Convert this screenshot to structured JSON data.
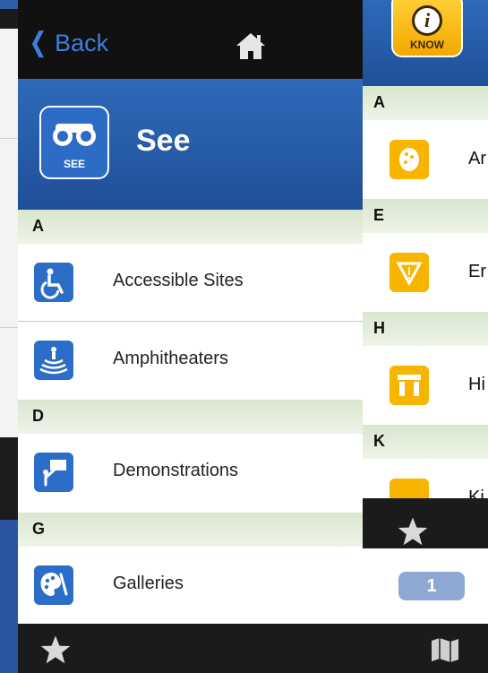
{
  "nav": {
    "back_label": "Back"
  },
  "see": {
    "title": "See",
    "icon_label": "SEE",
    "sections": [
      {
        "letter": "A",
        "items": [
          {
            "label": "Accessible Sites",
            "icon": "wheelchair-icon"
          },
          {
            "label": "Amphitheaters",
            "icon": "amphitheater-icon"
          }
        ]
      },
      {
        "letter": "D",
        "items": [
          {
            "label": "Demonstrations",
            "icon": "demonstration-icon"
          }
        ]
      },
      {
        "letter": "G",
        "items": [
          {
            "label": "Galleries",
            "icon": "palette-icon",
            "badge": "1"
          }
        ]
      }
    ]
  },
  "know": {
    "icon_label": "KNOW",
    "sections": [
      {
        "letter": "A",
        "item_text": "Ar"
      },
      {
        "letter": "E",
        "item_text": "Er"
      },
      {
        "letter": "H",
        "item_text": "Hi"
      },
      {
        "letter": "K",
        "item_text": "Ki"
      }
    ]
  },
  "colors": {
    "accent_blue": "#2c6ec7",
    "know_yellow": "#f7b500",
    "back_blue": "#3d7ee0"
  }
}
